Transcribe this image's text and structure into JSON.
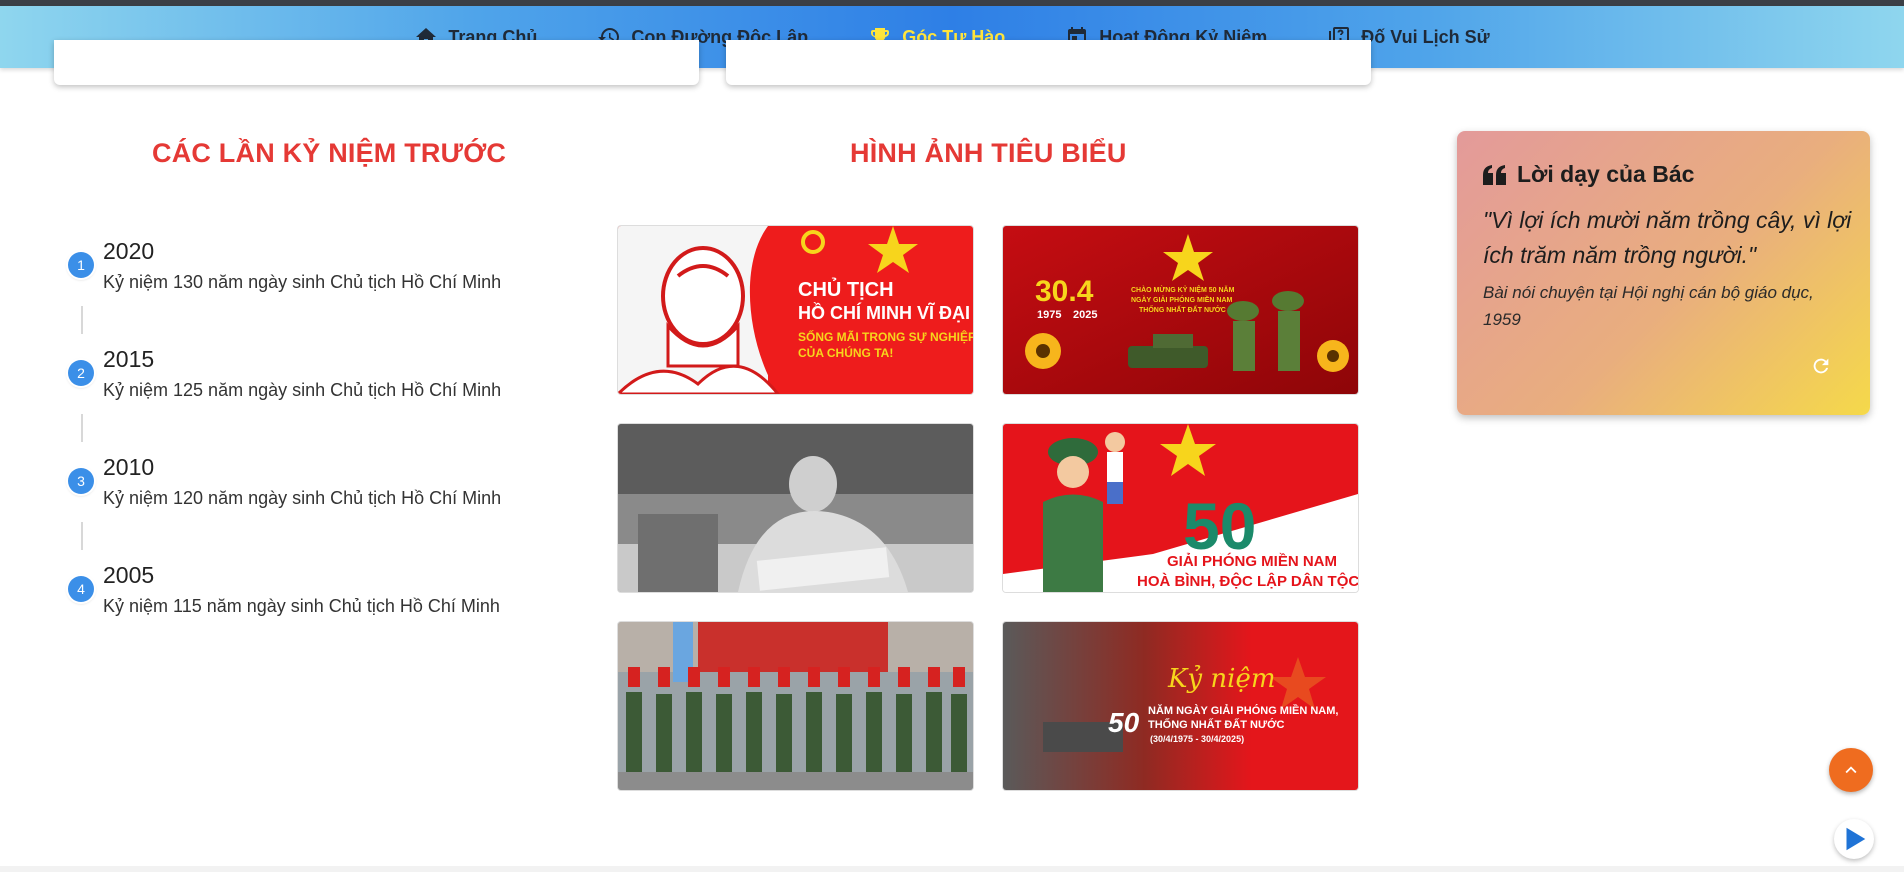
{
  "nav": {
    "items": [
      {
        "label": "Trang Chủ",
        "icon": "home-icon"
      },
      {
        "label": "Con Đường Độc Lập",
        "icon": "history-icon"
      },
      {
        "label": "Góc Tự Hào",
        "icon": "trophy-icon",
        "active": true
      },
      {
        "label": "Hoạt Động Kỷ Niệm",
        "icon": "calendar-icon"
      },
      {
        "label": "Đố Vui Lịch Sử",
        "icon": "quiz-icon"
      }
    ],
    "active_color": "#ffe53b"
  },
  "history": {
    "title": "CÁC LẦN KỶ NIỆM TRƯỚC",
    "items": [
      {
        "num": "1",
        "year": "2020",
        "desc": "Kỷ niệm 130 năm ngày sinh Chủ tịch Hồ Chí Minh"
      },
      {
        "num": "2",
        "year": "2015",
        "desc": "Kỷ niệm 125 năm ngày sinh Chủ tịch Hồ Chí Minh"
      },
      {
        "num": "3",
        "year": "2010",
        "desc": "Kỷ niệm 120 năm ngày sinh Chủ tịch Hồ Chí Minh"
      },
      {
        "num": "4",
        "year": "2005",
        "desc": "Kỷ niệm 115 năm ngày sinh Chủ tịch Hồ Chí Minh"
      }
    ]
  },
  "gallery": {
    "title": "HÌNH ẢNH TIÊU BIỂU",
    "images": [
      {
        "name": "ho-chi-minh-poster",
        "lines": [
          "CHỦ TỊCH",
          "HỒ CHÍ MINH VĨ ĐẠI",
          "SỐNG MÃI TRONG SỰ NGHIỆP",
          "CỦA CHÚNG TA!"
        ]
      },
      {
        "name": "reunification-poster",
        "lines": [
          "30.4",
          "1975",
          "2025",
          "CHÀO MỪNG KỶ NIỆM 50 NĂM",
          "NGÀY GIẢI PHÓNG MIỀN NAM",
          "THỐNG NHẤT ĐẤT NƯỚC"
        ]
      },
      {
        "name": "ho-chi-minh-writing-photo",
        "lines": []
      },
      {
        "name": "soldier-50-years-poster",
        "lines": [
          "50",
          "GIẢI PHÓNG MIỀN NAM",
          "HOÀ BÌNH, ĐỘC LẬP DÂN TỘC"
        ]
      },
      {
        "name": "military-parade-photo",
        "lines": []
      },
      {
        "name": "ky-niem-50-nam-banner",
        "lines": [
          "Kỷ niệm",
          "50",
          "NĂM NGÀY GIẢI PHÓNG MIỀN NAM,",
          "THỐNG NHẤT ĐẤT NƯỚC",
          "(30/4/1975 - 30/4/2025)"
        ]
      }
    ]
  },
  "quote": {
    "heading": "Lời dạy của Bác",
    "text": "\"Vì lợi ích mười năm trồng cây, vì lợi ích trăm năm trồng người.\"",
    "source": "Bài nói chuyện tại Hội nghị cán bộ giáo dục, 1959"
  },
  "colors": {
    "accent_red": "#e53935",
    "timeline_blue": "#3b8fe8",
    "scroll_orange": "#ef6c1f"
  }
}
